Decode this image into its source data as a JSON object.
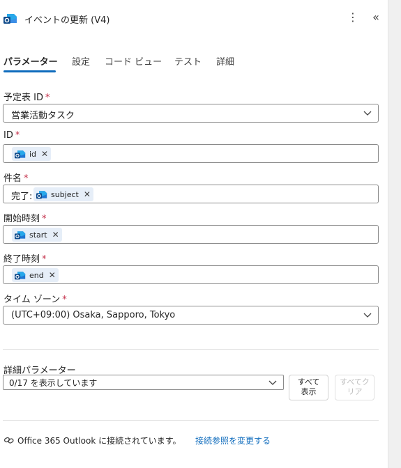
{
  "header": {
    "title": "イベントの更新 (V4)",
    "app_icon": "outlook-icon",
    "more_icon": "more-vertical-icon",
    "collapse_icon": "double-chevron-left-icon"
  },
  "tabs": [
    {
      "label": "パラメーター",
      "active": true
    },
    {
      "label": "設定"
    },
    {
      "label": "コード ビュー"
    },
    {
      "label": "テスト"
    },
    {
      "label": "詳細"
    }
  ],
  "fields": {
    "calendar": {
      "label": "予定表 ID",
      "required": "*",
      "value": "営業活動タスク"
    },
    "id": {
      "label": "ID",
      "required": "*",
      "token": "id"
    },
    "subject": {
      "label": "件名",
      "required": "*",
      "prefix": "完了:",
      "token": "subject"
    },
    "start": {
      "label": "開始時刻",
      "required": "*",
      "token": "start"
    },
    "end": {
      "label": "終了時刻",
      "required": "*",
      "token": "end"
    },
    "timezone": {
      "label": "タイム ゾーン",
      "required": "*",
      "value": "(UTC+09:00) Osaka, Sapporo, Tokyo"
    }
  },
  "advanced": {
    "label": "詳細パラメーター",
    "select_value": "0/17 を表示しています",
    "show_all_label": "すべて表示",
    "show_all_line1": "すべて",
    "show_all_line2": "表示",
    "clear_all_line1": "すべてク",
    "clear_all_line2": "リア"
  },
  "footer": {
    "text": "Office 365 Outlook に接続されています。",
    "link": "接続参照を変更する",
    "icon": "link-icon"
  },
  "colors": {
    "accent": "#0f6cbd",
    "required": "#c4314b",
    "token_bg": "#e6eef8"
  }
}
